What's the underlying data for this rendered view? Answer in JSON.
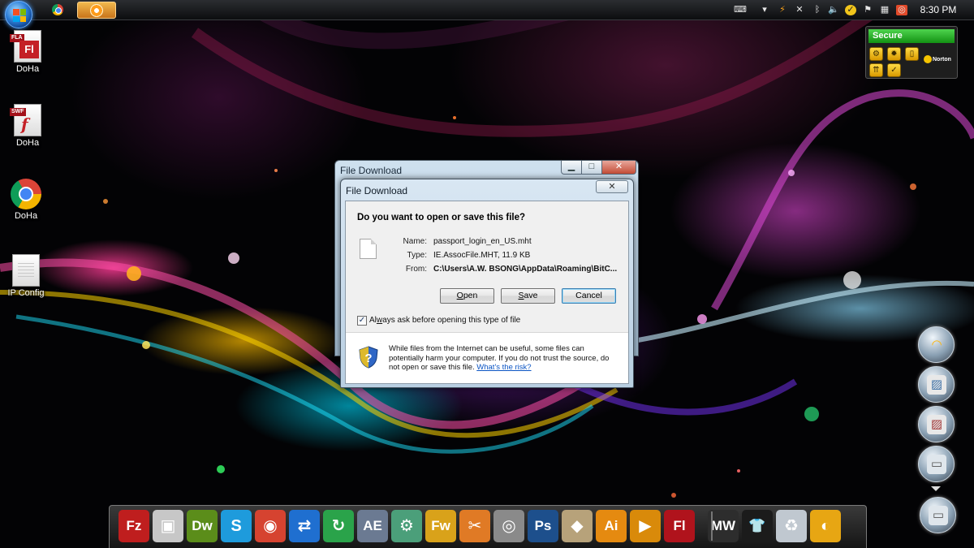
{
  "taskbar": {
    "clock": "8:30 PM",
    "tray_icons": [
      "keyboard-icon",
      "tray-expand-icon",
      "signal-icon",
      "network-icon",
      "bluetooth-icon",
      "volume-icon",
      "norton-tray-icon",
      "flag-icon",
      "action-center-icon",
      "app-tray-icon"
    ]
  },
  "desktop_icons": [
    {
      "label": "DoHa",
      "badge": "FLA",
      "glyph": "Fl"
    },
    {
      "label": "DoHa",
      "badge": "SWF",
      "glyph": "f"
    },
    {
      "label": "DoHa"
    },
    {
      "label": "IP Config"
    }
  ],
  "norton": {
    "status": "Secure",
    "brand": "Norton",
    "accent": "#19a619"
  },
  "behind_window": {
    "title": "File Download",
    "min_glyph": "▁",
    "max_glyph": "□",
    "close_glyph": "✕"
  },
  "dialog": {
    "title": "File Download",
    "close_glyph": "✕",
    "question": "Do you want to open or save this file?",
    "name_label": "Name:",
    "name_value": "passport_login_en_US.mht",
    "type_label": "Type:",
    "type_value": "IE.AssocFile.MHT, 11.9 KB",
    "from_label": "From:",
    "from_value": "C:\\Users\\A.W. BSONG\\AppData\\Roaming\\BitC...",
    "open_first": "O",
    "open_rest": "pen",
    "save_first": "S",
    "save_rest": "ave",
    "cancel_label": "Cancel",
    "checkbox_checked": true,
    "checkbox_label_prefix": "Al",
    "checkbox_label_ul": "w",
    "checkbox_label_suffix": "ays ask before opening this type of file",
    "warning_text": "While files from the Internet can be useful, some files can potentially harm your computer. If you do not trust the source, do not open or save this file.",
    "warning_link": "What's the risk?"
  },
  "dock": {
    "items": [
      {
        "icon": "filezilla-icon",
        "glyph": "Fz",
        "color": "#bf1e1e"
      },
      {
        "icon": "computer-icon",
        "glyph": "▣",
        "color": "#c7c7c7"
      },
      {
        "icon": "dreamweaver-icon",
        "glyph": "Dw",
        "color": "#5b8d1a"
      },
      {
        "icon": "skype-icon",
        "glyph": "S",
        "color": "#1e9bdc"
      },
      {
        "icon": "app-red-icon",
        "glyph": "◉",
        "color": "#d64330"
      },
      {
        "icon": "teamviewer-icon",
        "glyph": "⇄",
        "color": "#1f6fd0"
      },
      {
        "icon": "sync-icon",
        "glyph": "↻",
        "color": "#2aa34a"
      },
      {
        "icon": "after-effects-icon",
        "glyph": "AE",
        "color": "#6b7a92"
      },
      {
        "icon": "network-globe-icon",
        "glyph": "⚙",
        "color": "#4b9f7a"
      },
      {
        "icon": "fireworks-icon",
        "glyph": "Fw",
        "color": "#d9a21a"
      },
      {
        "icon": "tools-icon",
        "glyph": "✂",
        "color": "#e07a25"
      },
      {
        "icon": "media-player-icon",
        "glyph": "◎",
        "color": "#8a8a8a"
      },
      {
        "icon": "photoshop-icon",
        "glyph": "Ps",
        "color": "#1d4f8c"
      },
      {
        "icon": "package-icon",
        "glyph": "◆",
        "color": "#b7a27a"
      },
      {
        "icon": "illustrator-icon",
        "glyph": "Ai",
        "color": "#e58a10"
      },
      {
        "icon": "play-icon",
        "glyph": "▶",
        "color": "#d98a0a"
      },
      {
        "icon": "flash-icon",
        "glyph": "Fl",
        "color": "#b0131c"
      },
      {
        "icon": "mw-icon",
        "glyph": "MW",
        "color": "#2d2d2d"
      },
      {
        "icon": "shirt-icon",
        "glyph": "👕",
        "color": "#1b1b1b"
      },
      {
        "icon": "recycle-bin-icon",
        "glyph": "♻",
        "color": "#c0c8d0"
      },
      {
        "icon": "cd-icon",
        "glyph": "◐",
        "color": "#e7a613"
      }
    ]
  }
}
